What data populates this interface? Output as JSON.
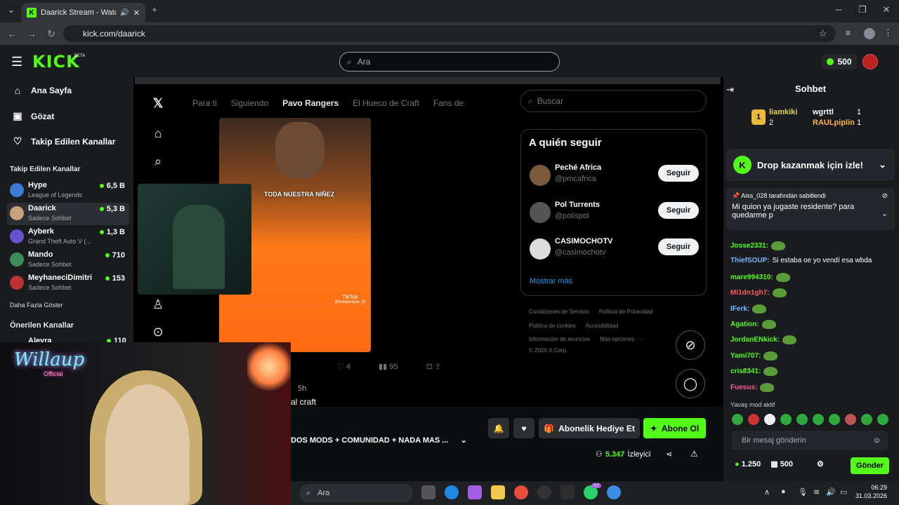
{
  "browser": {
    "tab_title": "Daarick Stream - Watch Live",
    "url": "kick.com/daarick"
  },
  "header": {
    "logo": "KICK",
    "beta": "BETA",
    "search_placeholder": "Ara",
    "points": "500"
  },
  "sidebar": {
    "nav": [
      {
        "label": "Ana Sayfa",
        "icon": "home-icon"
      },
      {
        "label": "Gözat",
        "icon": "browse-icon"
      },
      {
        "label": "Takip Edilen Kanallar",
        "icon": "heart-icon"
      }
    ],
    "followed_title": "Takip Edilen Kanallar",
    "channels": [
      {
        "name": "Hype",
        "category": "League of Legends",
        "viewers": "6,5 B",
        "color": "#3a7bd5"
      },
      {
        "name": "Daarick",
        "category": "Sadece Sohbet",
        "viewers": "5,3 B",
        "color": "#c8a27a"
      },
      {
        "name": "Ayberk",
        "category": "Grand Theft Auto V (...",
        "viewers": "1,3 B",
        "color": "#6a4fd0"
      },
      {
        "name": "Mando",
        "category": "Sadece Sohbet",
        "viewers": "710",
        "color": "#3c8c5a"
      },
      {
        "name": "MeyhaneciDimitri",
        "category": "Sadece Sohbet",
        "viewers": "153",
        "color": "#b33"
      }
    ],
    "show_more": "Daha Fazla Göster",
    "recommended_title": "Önerilen Kanallar",
    "rec_partial": "Alevra",
    "rec_partial_viewers": "110"
  },
  "stream": {
    "x_tabs": [
      "Para ti",
      "Siguiendo",
      "Pavo Rangers",
      "El Hueco de Craft",
      "Fans de"
    ],
    "x_active_tab": "Pavo Rangers",
    "tiktok_caption": "TODA NUESTRA NIÑEZ",
    "tiktok_label": "TikTok",
    "tiktok_handle": "@luisenrique_fit",
    "likes": "4",
    "views": "95",
    "post_time": "5h",
    "post_text_partial": "al craft",
    "x_search": "Buscar",
    "who_to_follow": "A quién seguir",
    "follow_suggestions": [
      {
        "name": "Peché Africa",
        "handle": "@pmcafrica",
        "btn": "Seguir"
      },
      {
        "name": "Pol Turrents",
        "handle": "@polispol",
        "btn": "Seguir"
      },
      {
        "name": "CASIMOCHOTV",
        "handle": "@casimochotv",
        "btn": "Seguir"
      }
    ],
    "show_more": "Mostrar más",
    "footer_links_1": [
      "Condiciones de Servicio",
      "Política de Privacidad"
    ],
    "footer_links_2": [
      "Política de cookies",
      "Accesibilidad"
    ],
    "footer_links_3": [
      "Información de anuncios",
      "Más opciones ···"
    ],
    "copyright": "© 2026 X Corp.",
    "streamer_neon": "Willaup",
    "streamer_neon_sub": "Official"
  },
  "below_stream": {
    "title": "DOS MODS + COMUNIDAD + NADA MAS ...",
    "gift_label": "Abonelik Hediye Et",
    "subscribe_label": "Abone Ol",
    "viewer_count": "5.347",
    "viewer_label": "İzleyici"
  },
  "chat": {
    "title": "Sohbet",
    "leaderboard": [
      {
        "rank": "1",
        "name": "liamkiki",
        "count": "2"
      },
      {
        "name": "wgrttl",
        "count": "1"
      },
      {
        "name": "RAULpiplin",
        "count": "1"
      }
    ],
    "drop_text": "Drop kazanmak için izle!",
    "pinned_by": "Aiss_028 tarafından sabitlendi",
    "pinned_msg": "Mi quion ya jugaste residente? para quedarme p",
    "messages": [
      {
        "user": "Josse2331:",
        "text": "",
        "color": "#53fc18",
        "emote": true
      },
      {
        "user": "ThiefSOUP:",
        "text": "Si estaba oe yo vendí esa wbda",
        "color": "#79b8ff",
        "emote": false
      },
      {
        "user": "mare994310:",
        "text": "",
        "color": "#53fc18",
        "emote": true
      },
      {
        "user": "Mi1dn1gh7:",
        "text": "",
        "color": "#ff5a5a",
        "emote": true
      },
      {
        "user": "IFerk:",
        "text": "",
        "color": "#79b8ff",
        "emote": true
      },
      {
        "user": "Agation:",
        "text": "",
        "color": "#53fc18",
        "emote": true
      },
      {
        "user": "JordanENkick:",
        "text": "",
        "color": "#53fc18",
        "emote": true
      },
      {
        "user": "Yami707:",
        "text": "",
        "color": "#53fc18",
        "emote": true
      },
      {
        "user": "cris8341:",
        "text": "",
        "color": "#53fc18",
        "emote": true
      },
      {
        "user": "Fuesus:",
        "text": "",
        "color": "#ff5a9a",
        "emote": true
      }
    ],
    "slow_mode": "Yavaş mod aktif",
    "input_placeholder": "Bir mesaj gönderin",
    "balance": "1.250",
    "points": "500",
    "send_label": "Gönder"
  },
  "taskbar": {
    "search_label": "Ara",
    "time": "06:29",
    "date": "31.03.2026",
    "badge": "17"
  },
  "colors": {
    "kick_green": "#53fc18",
    "bg": "#0b0e0f",
    "panel": "#191b1f"
  }
}
